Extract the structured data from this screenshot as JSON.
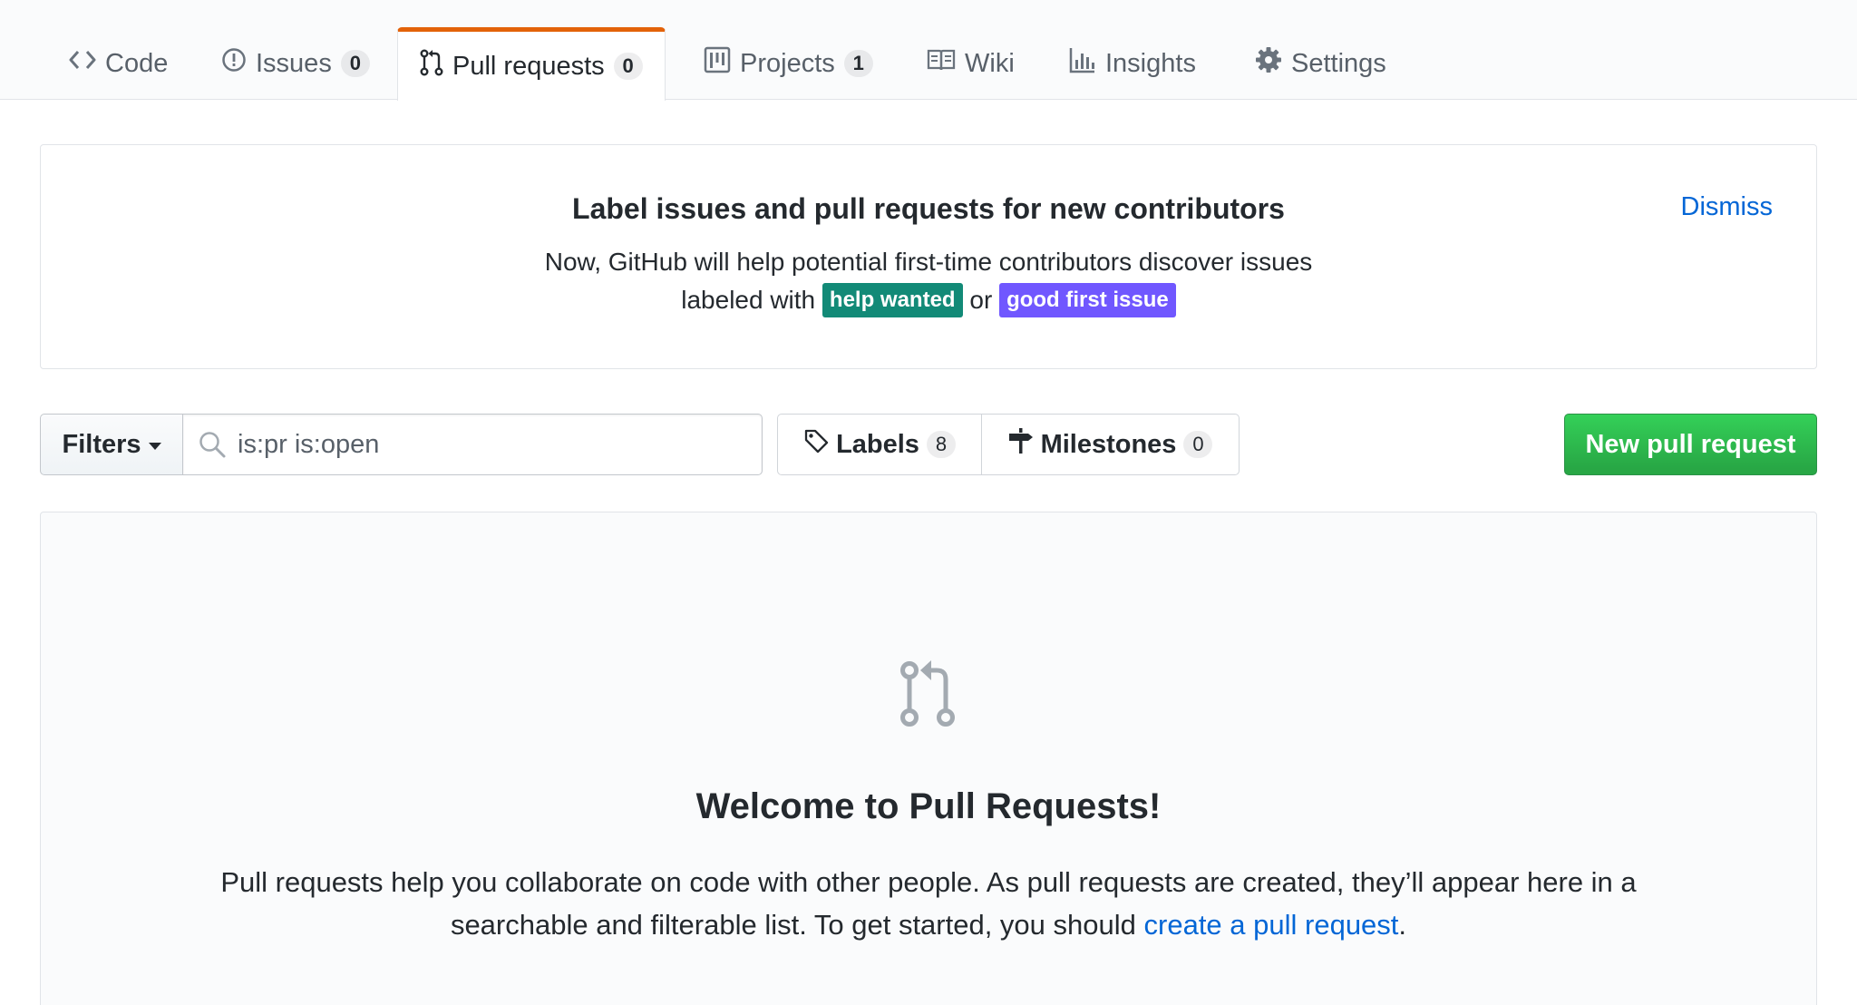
{
  "tabs": [
    {
      "label": "Code",
      "icon": "code-icon"
    },
    {
      "label": "Issues",
      "icon": "issue-opened-icon",
      "count": "0"
    },
    {
      "label": "Pull requests",
      "icon": "git-pull-request-icon",
      "count": "0",
      "selected": true
    },
    {
      "label": "Projects",
      "icon": "project-icon",
      "count": "1"
    },
    {
      "label": "Wiki",
      "icon": "book-icon"
    },
    {
      "label": "Insights",
      "icon": "graph-icon"
    },
    {
      "label": "Settings",
      "icon": "gear-icon"
    }
  ],
  "banner": {
    "title": "Label issues and pull requests for new contributors",
    "text_line1": "Now, GitHub will help potential first-time contributors discover issues",
    "text_prefix": "labeled with",
    "label_help_wanted": "help wanted",
    "label_help_wanted_color": "#128a77",
    "or_text": "or",
    "label_good_first_issue": "good first issue",
    "label_good_first_issue_color": "#7057ff",
    "dismiss_label": "Dismiss"
  },
  "toolbar": {
    "filters_label": "Filters",
    "search_value": "is:pr is:open",
    "labels_label": "Labels",
    "labels_count": "8",
    "milestones_label": "Milestones",
    "milestones_count": "0",
    "new_pr_label": "New pull request"
  },
  "blankslate": {
    "title": "Welcome to Pull Requests!",
    "text": "Pull requests help you collaborate on code with other people. As pull requests are created, they’ll appear here in a searchable and filterable list. To get started, you should",
    "link_text": "create a pull request",
    "suffix": "."
  },
  "colors": {
    "accent_tab": "#e36209",
    "link": "#0366d6",
    "primary_button": "#28a745"
  }
}
